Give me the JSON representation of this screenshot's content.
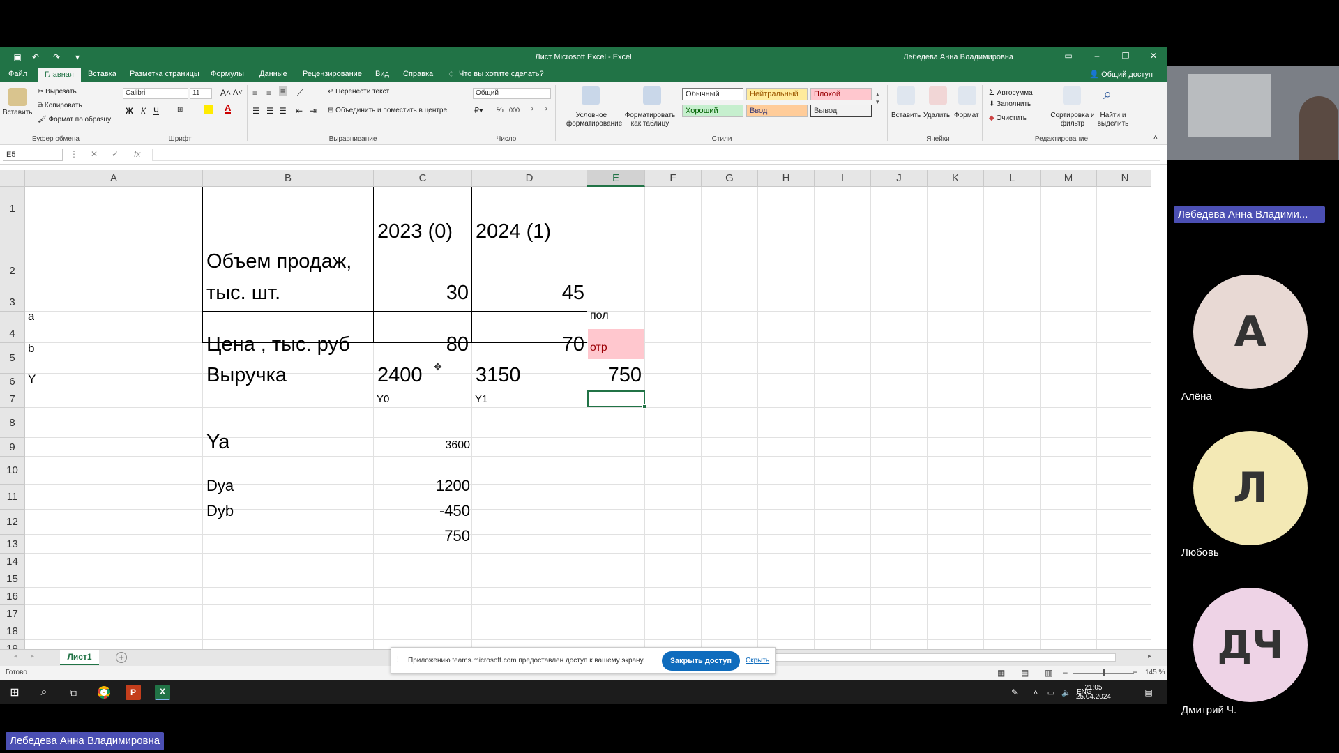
{
  "window": {
    "title": "Лист Microsoft Excel  -  Excel",
    "user": "Лебедева Анна Владимировна"
  },
  "tabs": [
    "Файл",
    "Главная",
    "Вставка",
    "Разметка страницы",
    "Формулы",
    "Данные",
    "Рецензирование",
    "Вид",
    "Справка"
  ],
  "tell_me": "Что вы хотите сделать?",
  "share_label": "Общий доступ",
  "ribbon": {
    "clipboard": {
      "paste": "Вставить",
      "cut": "Вырезать",
      "copy": "Копировать",
      "format_painter": "Формат по образцу",
      "group": "Буфер обмена"
    },
    "font": {
      "name": "Calibri",
      "size": "11",
      "bold": "Ж",
      "italic": "К",
      "underline": "Ч",
      "group": "Шрифт"
    },
    "alignment": {
      "wrap": "Перенести текст",
      "merge": "Объединить и поместить в центре",
      "group": "Выравнивание"
    },
    "number": {
      "format": "Общий",
      "group": "Число"
    },
    "styles": {
      "conditional": "Условное форматирование",
      "as_table": "Форматировать как таблицу",
      "normal": "Обычный",
      "neutral": "Нейтральный",
      "bad": "Плохой",
      "good": "Хороший",
      "input": "Ввод",
      "output": "Вывод",
      "group": "Стили"
    },
    "cells": {
      "insert": "Вставить",
      "delete": "Удалить",
      "format": "Формат",
      "group": "Ячейки"
    },
    "editing": {
      "autosum": "Автосумма",
      "fill": "Заполнить",
      "clear": "Очистить",
      "sort": "Сортировка и фильтр",
      "find": "Найти и выделить",
      "group": "Редактирование"
    }
  },
  "formula_bar": {
    "name_box": "E5",
    "fx": "fx",
    "content": ""
  },
  "columns": [
    "A",
    "B",
    "C",
    "D",
    "E",
    "F",
    "G",
    "H",
    "I",
    "J",
    "K",
    "L",
    "M",
    "N"
  ],
  "selected_column": "E",
  "rows": [
    "1",
    "2",
    "3",
    "4",
    "5",
    "6",
    "7",
    "8",
    "9",
    "10",
    "11",
    "12",
    "13",
    "14",
    "15",
    "16",
    "17",
    "18",
    "19"
  ],
  "cells": {
    "C1": "2023 (0)",
    "D1": "2024 (1)",
    "A2": "a",
    "B2_line1": "Объем продаж,",
    "B2_line2": "тыс. шт.",
    "C2": "30",
    "D2": "45",
    "E2": "пол",
    "A3": "b",
    "B3": "Цена , тыс. руб",
    "C3": "80",
    "D3": "70",
    "E3": "отр",
    "A4": "Y",
    "B4": "Выручка",
    "C4": "2400",
    "D4": "3150",
    "E4": "750",
    "C5": "Y0",
    "D5": "Y1",
    "B7": "Ya",
    "C7": "3600",
    "B9": "Dya",
    "C9": "1200",
    "B10": "Dyb",
    "C10": "-450",
    "C11": "750"
  },
  "sheet": {
    "name": "Лист1",
    "add": "+"
  },
  "status": {
    "ready": "Готово",
    "zoom": "145 %"
  },
  "share_banner": {
    "text": "Приложению teams.microsoft.com предоставлен доступ к вашему экрану.",
    "stop": "Закрыть доступ",
    "hide": "Скрыть"
  },
  "taskbar": {
    "lang": "ENG",
    "time": "21:05",
    "date": "25.04.2024"
  },
  "meeting": {
    "presenter": "Лебедева Анна Владими...",
    "self_name": "Лебедева Анна Владимировна",
    "participants": [
      {
        "initials": "А",
        "name": "Алёна",
        "color": "#e8d9d4"
      },
      {
        "initials": "Л",
        "name": "Любовь",
        "color": "#f3e9b5"
      },
      {
        "initials": "ДЧ",
        "name": "Дмитрий Ч.",
        "color": "#eed3e6"
      }
    ]
  },
  "colors": {
    "excel_green": "#217346",
    "bad_fill": "#ffc7ce",
    "teams_purple": "#4b4fb3"
  }
}
